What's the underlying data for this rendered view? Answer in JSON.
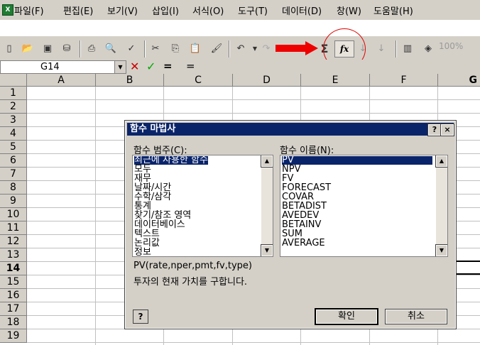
{
  "menubar": {
    "items": [
      "파일(F)",
      "편집(E)",
      "보기(V)",
      "삽입(I)",
      "서식(O)",
      "도구(T)",
      "데이터(D)",
      "창(W)",
      "도움말(H)"
    ]
  },
  "toolbar": {
    "icons": [
      "new-file-icon",
      "open-icon",
      "save-icon",
      "permission-icon",
      "print-icon",
      "print-preview-icon",
      "spelling-icon",
      "cut-icon",
      "copy-icon",
      "paste-icon",
      "format-painter-icon",
      "undo-icon",
      "redo-icon",
      "autosum-icon",
      "insert-function-icon",
      "sort-ascending-icon",
      "sort-descending-icon",
      "chart-wizard-icon",
      "drawing-icon"
    ],
    "autosum_symbol": "Σ",
    "fx_label": "fx",
    "zoom": "100%",
    "accent_arrow_color": "#ee0000"
  },
  "formula_bar": {
    "name_box": "G14",
    "cancel": "✕",
    "enter": "✓",
    "equals": "=",
    "content": "="
  },
  "grid": {
    "columns": [
      "A",
      "B",
      "C",
      "D",
      "E",
      "F",
      "G"
    ],
    "rows": [
      "1",
      "2",
      "3",
      "4",
      "5",
      "6",
      "7",
      "8",
      "9",
      "10",
      "11",
      "12",
      "13",
      "14",
      "15",
      "16",
      "17",
      "18",
      "19"
    ],
    "active_row": "14"
  },
  "dialog": {
    "title": "함수 마법사",
    "help_button": "?",
    "close_button": "×",
    "category_label": "함수 범주(C):",
    "categories": [
      "최근에 사용한 함수",
      "모두",
      "재무",
      "날짜/시간",
      "수학/삼각",
      "통계",
      "찾기/참조 영역",
      "데이터베이스",
      "텍스트",
      "논리값",
      "정보"
    ],
    "selected_category": 0,
    "name_label": "함수 이름(N):",
    "functions": [
      "PV",
      "NPV",
      "FV",
      "FORECAST",
      "COVAR",
      "BETADIST",
      "AVEDEV",
      "BETAINV",
      "SUM",
      "AVERAGE"
    ],
    "selected_function": 0,
    "syntax": "PV(rate,nper,pmt,fv,type)",
    "description": "투자의 현재 가치를 구합니다.",
    "ok_label": "확인",
    "cancel_label": "취소",
    "help_icon_label": "?"
  }
}
